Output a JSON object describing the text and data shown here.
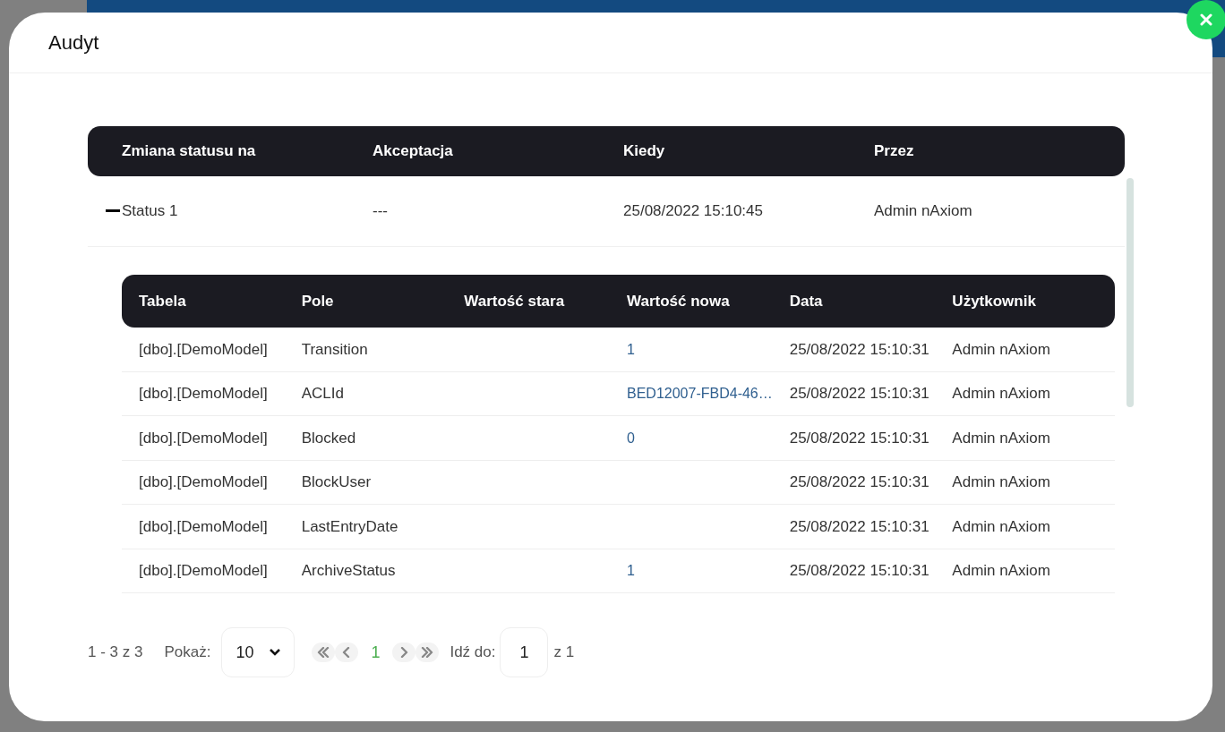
{
  "dialog": {
    "title": "Audyt",
    "columns": [
      "Zmiana statusu na",
      "Akceptacja",
      "Kiedy",
      "Przez"
    ],
    "rows": [
      {
        "expanded": true,
        "cells": [
          "Status 1",
          "---",
          "25/08/2022 15:10:45",
          "Admin nAxiom"
        ],
        "details": {
          "columns": [
            "Tabela",
            "Pole",
            "Wartość stara",
            "Wartość nowa",
            "Data",
            "Użytkownik"
          ],
          "rows": [
            [
              "[dbo].[DemoModel]",
              "Transition",
              "",
              "1",
              "25/08/2022 15:10:31",
              "Admin nAxiom"
            ],
            [
              "[dbo].[DemoModel]",
              "ACLId",
              "",
              "BED12007-FBD4-46…",
              "25/08/2022 15:10:31",
              "Admin nAxiom"
            ],
            [
              "[dbo].[DemoModel]",
              "Blocked",
              "",
              "0",
              "25/08/2022 15:10:31",
              "Admin nAxiom"
            ],
            [
              "[dbo].[DemoModel]",
              "BlockUser",
              "",
              "",
              "25/08/2022 15:10:31",
              "Admin nAxiom"
            ],
            [
              "[dbo].[DemoModel]",
              "LastEntryDate",
              "",
              "",
              "25/08/2022 15:10:31",
              "Admin nAxiom"
            ],
            [
              "[dbo].[DemoModel]",
              "ArchiveStatus",
              "",
              "1",
              "25/08/2022 15:10:31",
              "Admin nAxiom"
            ]
          ]
        }
      }
    ],
    "pagination": {
      "range": "1 - 3 z 3",
      "show_label": "Pokaż:",
      "page_size": "10",
      "current_page": "1",
      "goto_label": "Idź do:",
      "goto_value": "1",
      "total": "z 1"
    }
  }
}
